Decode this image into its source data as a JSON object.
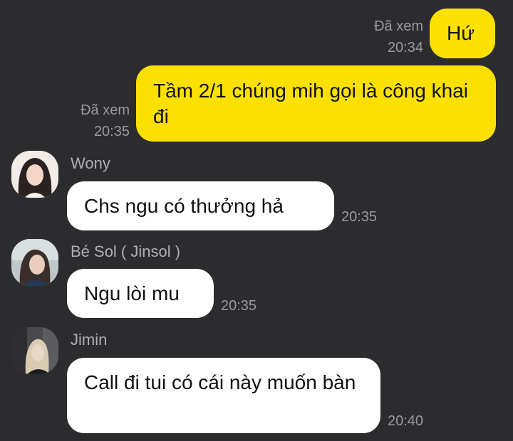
{
  "messages_out": [
    {
      "text": "Hứ",
      "read_label": "Đã xem",
      "time": "20:34"
    },
    {
      "text": "Tầm 2/1 chúng mih gọi là công khai đi",
      "read_label": "Đã xem",
      "time": "20:35"
    }
  ],
  "messages_in": [
    {
      "sender": "Wony",
      "text": "Chs ngu có thưởng hả",
      "time": "20:35",
      "avatar_icon": "avatar-photo-icon"
    },
    {
      "sender": "Bé Sol ( Jinsol )",
      "text": "Ngu lòi mu",
      "time": "20:35",
      "avatar_icon": "avatar-photo-icon"
    },
    {
      "sender": "Jimin",
      "text": "Call đi tui có cái này muốn bàn",
      "time": "20:40",
      "avatar_icon": "avatar-photo-icon"
    }
  ],
  "colors": {
    "background": "#2c2c2e",
    "outgoing_bubble": "#fce000",
    "incoming_bubble": "#ffffff",
    "meta_text": "#9a9a9e"
  }
}
